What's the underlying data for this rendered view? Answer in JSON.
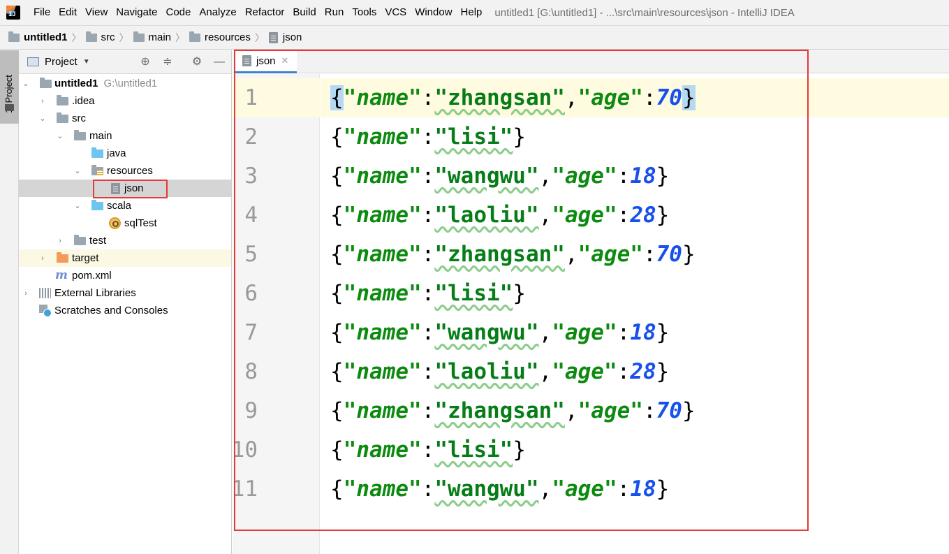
{
  "menubar": {
    "logo_text": "IJ",
    "items": [
      {
        "label": "File"
      },
      {
        "label": "Edit"
      },
      {
        "label": "View"
      },
      {
        "label": "Navigate"
      },
      {
        "label": "Code"
      },
      {
        "label": "Analyze"
      },
      {
        "label": "Refactor"
      },
      {
        "label": "Build"
      },
      {
        "label": "Run"
      },
      {
        "label": "Tools"
      },
      {
        "label": "VCS"
      },
      {
        "label": "Window"
      },
      {
        "label": "Help"
      }
    ],
    "window_title": "untitled1 [G:\\untitled1] - ...\\src\\main\\resources\\json - IntelliJ IDEA"
  },
  "breadcrumb": [
    "untitled1",
    "src",
    "main",
    "resources",
    "json"
  ],
  "toolstrip": {
    "project_tab": "1: Project"
  },
  "project_panel": {
    "title": "Project",
    "tree": [
      {
        "label": "untitled1",
        "hint": "G:\\untitled1",
        "icon": "module-folder-icon",
        "expanded": true
      },
      {
        "label": ".idea",
        "icon": "folder-icon",
        "expanded": false
      },
      {
        "label": "src",
        "icon": "folder-icon",
        "expanded": true
      },
      {
        "label": "main",
        "icon": "folder-icon",
        "expanded": true
      },
      {
        "label": "java",
        "icon": "source-folder-icon"
      },
      {
        "label": "resources",
        "icon": "resources-folder-icon",
        "expanded": true
      },
      {
        "label": "json",
        "icon": "text-file-icon",
        "selected": true
      },
      {
        "label": "scala",
        "icon": "source-folder-icon",
        "expanded": true
      },
      {
        "label": "sqlTest",
        "icon": "scala-object-icon"
      },
      {
        "label": "test",
        "icon": "folder-icon",
        "expanded": false
      },
      {
        "label": "target",
        "icon": "excluded-folder-icon",
        "expanded": false
      },
      {
        "label": "pom.xml",
        "icon": "maven-icon"
      },
      {
        "label": "External Libraries",
        "icon": "libraries-icon",
        "expanded": false
      },
      {
        "label": "Scratches and Consoles",
        "icon": "scratches-icon"
      }
    ]
  },
  "editor": {
    "tab_label": "json",
    "current_line": 1,
    "lines": [
      {
        "n": "1",
        "name": "zhangsan",
        "age": "70"
      },
      {
        "n": "2",
        "name": "lisi"
      },
      {
        "n": "3",
        "name": "wangwu",
        "age": "18"
      },
      {
        "n": "4",
        "name": "laoliu",
        "age": "28"
      },
      {
        "n": "5",
        "name": "zhangsan",
        "age": "70"
      },
      {
        "n": "6",
        "name": "lisi"
      },
      {
        "n": "7",
        "name": "wangwu",
        "age": "18"
      },
      {
        "n": "8",
        "name": "laoliu",
        "age": "28"
      },
      {
        "n": "9",
        "name": "zhangsan",
        "age": "70"
      },
      {
        "n": "10",
        "name": "lisi"
      },
      {
        "n": "11",
        "name": "wangwu",
        "age": "18"
      }
    ]
  },
  "colors": {
    "annotation": "#e53935",
    "string": "#067d17",
    "number": "#1750eb",
    "selection": "#d5d5d5",
    "current_line": "#fffbe0"
  }
}
